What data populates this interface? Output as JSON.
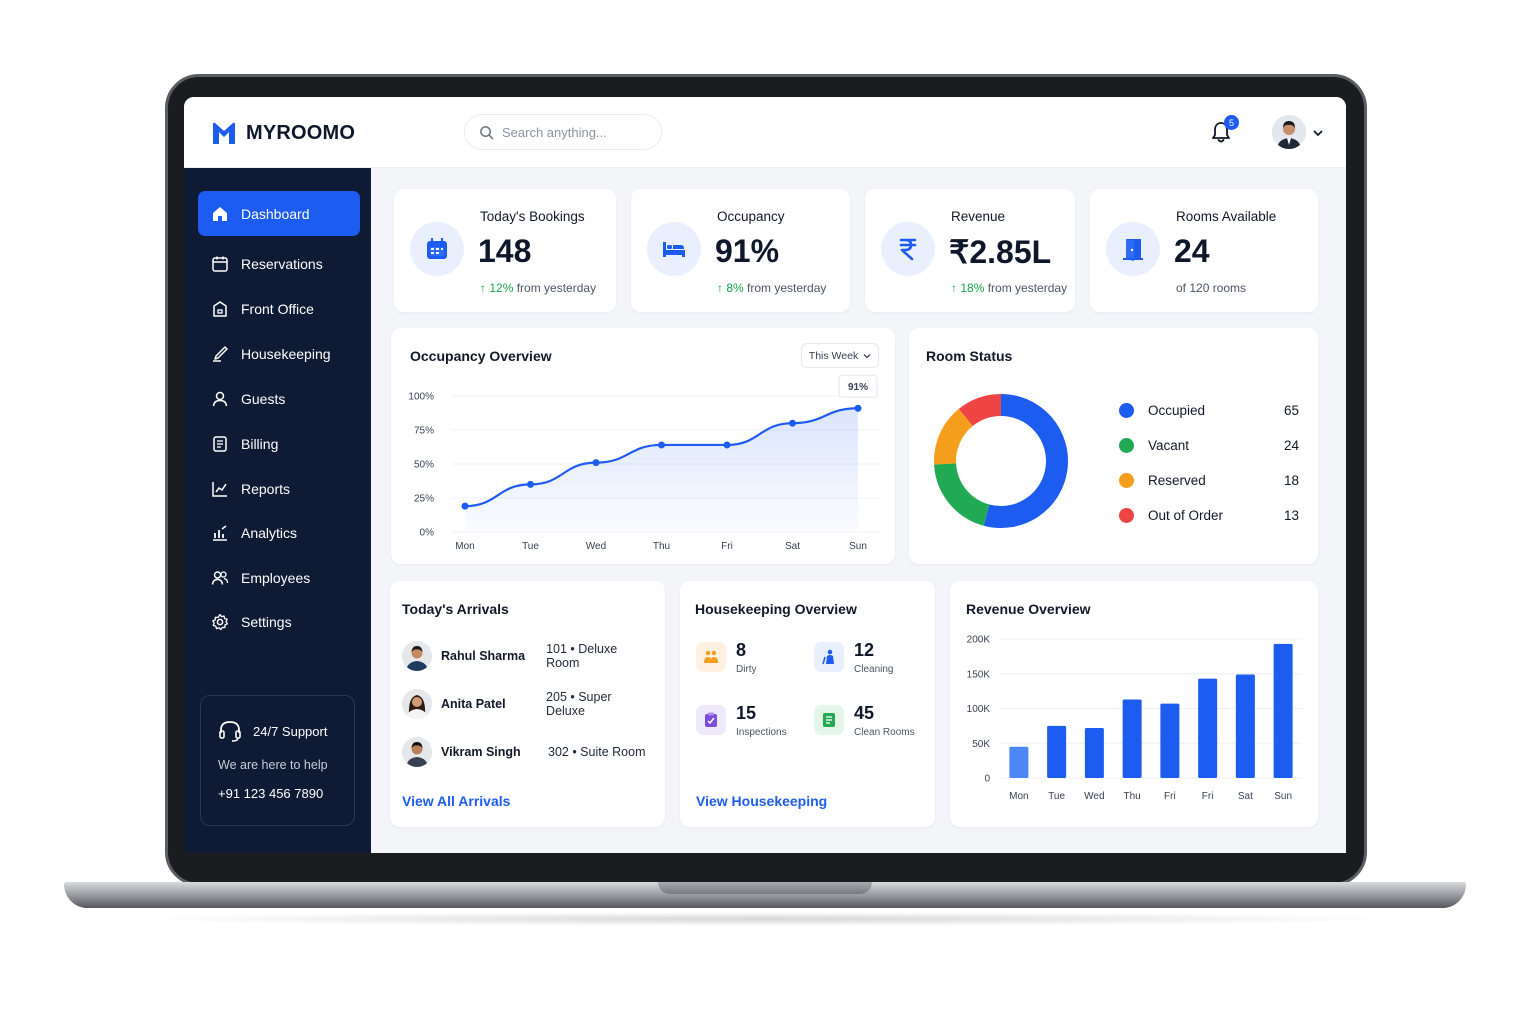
{
  "brand": {
    "name": "MYROOMO",
    "accent": "#1d5cf0",
    "sidebar_bg": "#0f1b34"
  },
  "search": {
    "placeholder": "Search anything..."
  },
  "notifications": {
    "count": "5",
    "icon": "bell-icon"
  },
  "sidebar": {
    "items": [
      {
        "label": "Dashboard",
        "icon": "home-icon",
        "active": true
      },
      {
        "label": "Reservations",
        "icon": "calendar-icon"
      },
      {
        "label": "Front Office",
        "icon": "briefcase-icon"
      },
      {
        "label": "Housekeeping",
        "icon": "brush-icon"
      },
      {
        "label": "Guests",
        "icon": "person-icon"
      },
      {
        "label": "Billing",
        "icon": "receipt-icon"
      },
      {
        "label": "Reports",
        "icon": "report-icon"
      },
      {
        "label": "Analytics",
        "icon": "analytics-icon"
      },
      {
        "label": "Employees",
        "icon": "users-icon"
      },
      {
        "label": "Settings",
        "icon": "gear-icon"
      }
    ],
    "support": {
      "title": "24/7 Support",
      "subtitle": "We are here to help",
      "phone": "+91 123 456 7890"
    }
  },
  "stats": [
    {
      "label": "Today's Bookings",
      "value": "148",
      "change": "12%",
      "suffix": "from yesterday",
      "icon": "calendar-icon"
    },
    {
      "label": "Occupancy",
      "value": "91%",
      "change": "8%",
      "suffix": "from yesterday",
      "icon": "bed-icon"
    },
    {
      "label": "Revenue",
      "value": "₹2.85L",
      "change": "18%",
      "suffix": "from yesterday",
      "icon": "rupee-icon"
    },
    {
      "label": "Rooms Available",
      "value": "24",
      "change": "",
      "suffix": "of 120 rooms",
      "icon": "door-icon"
    }
  ],
  "occupancy_overview": {
    "title": "Occupancy Overview",
    "period": "This Week",
    "callout": "91%"
  },
  "room_status": {
    "title": "Room Status",
    "items": [
      {
        "label": "Occupied",
        "value": "65",
        "color": "#1d5cf0"
      },
      {
        "label": "Vacant",
        "value": "24",
        "color": "#22a954"
      },
      {
        "label": "Reserved",
        "value": "18",
        "color": "#f59e1b"
      },
      {
        "label": "Out of Order",
        "value": "13",
        "color": "#ef4444"
      }
    ]
  },
  "arrivals": {
    "title": "Today's Arrivals",
    "rows": [
      {
        "name": "Rahul Sharma",
        "room": "101 • Deluxe Room"
      },
      {
        "name": "Anita Patel",
        "room": "205 • Super Deluxe"
      },
      {
        "name": "Vikram Singh",
        "room": "302 • Suite Room"
      }
    ],
    "link": "View All Arrivals"
  },
  "housekeeping": {
    "title": "Housekeeping Overview",
    "items": [
      {
        "value": "8",
        "label": "Dirty",
        "icon": "broom-icon",
        "color": "#f59e1b",
        "bg": "#fff1e2"
      },
      {
        "value": "12",
        "label": "Cleaning",
        "icon": "cleaning-icon",
        "color": "#1d5cf0",
        "bg": "#e9effd"
      },
      {
        "value": "15",
        "label": "Inspections",
        "icon": "clipboard-icon",
        "color": "#7c4ddc",
        "bg": "#efe9fc"
      },
      {
        "value": "45",
        "label": "Clean Rooms",
        "icon": "checklist-icon",
        "color": "#22a954",
        "bg": "#e5f6eb"
      }
    ],
    "link": "View Housekeeping"
  },
  "revenue_overview": {
    "title": "Revenue Overview"
  },
  "chart_data": [
    {
      "type": "area",
      "title": "Occupancy Overview",
      "categories": [
        "Mon",
        "Tue",
        "Wed",
        "Thu",
        "Fri",
        "Sat",
        "Sun"
      ],
      "series": [
        {
          "values": [
            19,
            35,
            51,
            64,
            64,
            80,
            91
          ]
        }
      ],
      "yticks": [
        "0%",
        "25%",
        "50%",
        "75%",
        "100%"
      ],
      "ylim": [
        0,
        100
      ],
      "grid": true
    },
    {
      "type": "pie",
      "title": "Room Status",
      "categories": [
        "Occupied",
        "Vacant",
        "Reserved",
        "Out of Order"
      ],
      "values": [
        65,
        24,
        18,
        13
      ]
    },
    {
      "type": "bar",
      "title": "Revenue Overview",
      "categories": [
        "Mon",
        "Tue",
        "Wed",
        "Thu",
        "Fri",
        "Fri",
        "Sat",
        "Sun"
      ],
      "values": [
        45000,
        75000,
        72000,
        113000,
        107000,
        143000,
        149000,
        193000
      ],
      "yticks": [
        "0",
        "50K",
        "100K",
        "150K",
        "200K"
      ],
      "ylim": [
        0,
        200000
      ],
      "grid": true
    }
  ]
}
